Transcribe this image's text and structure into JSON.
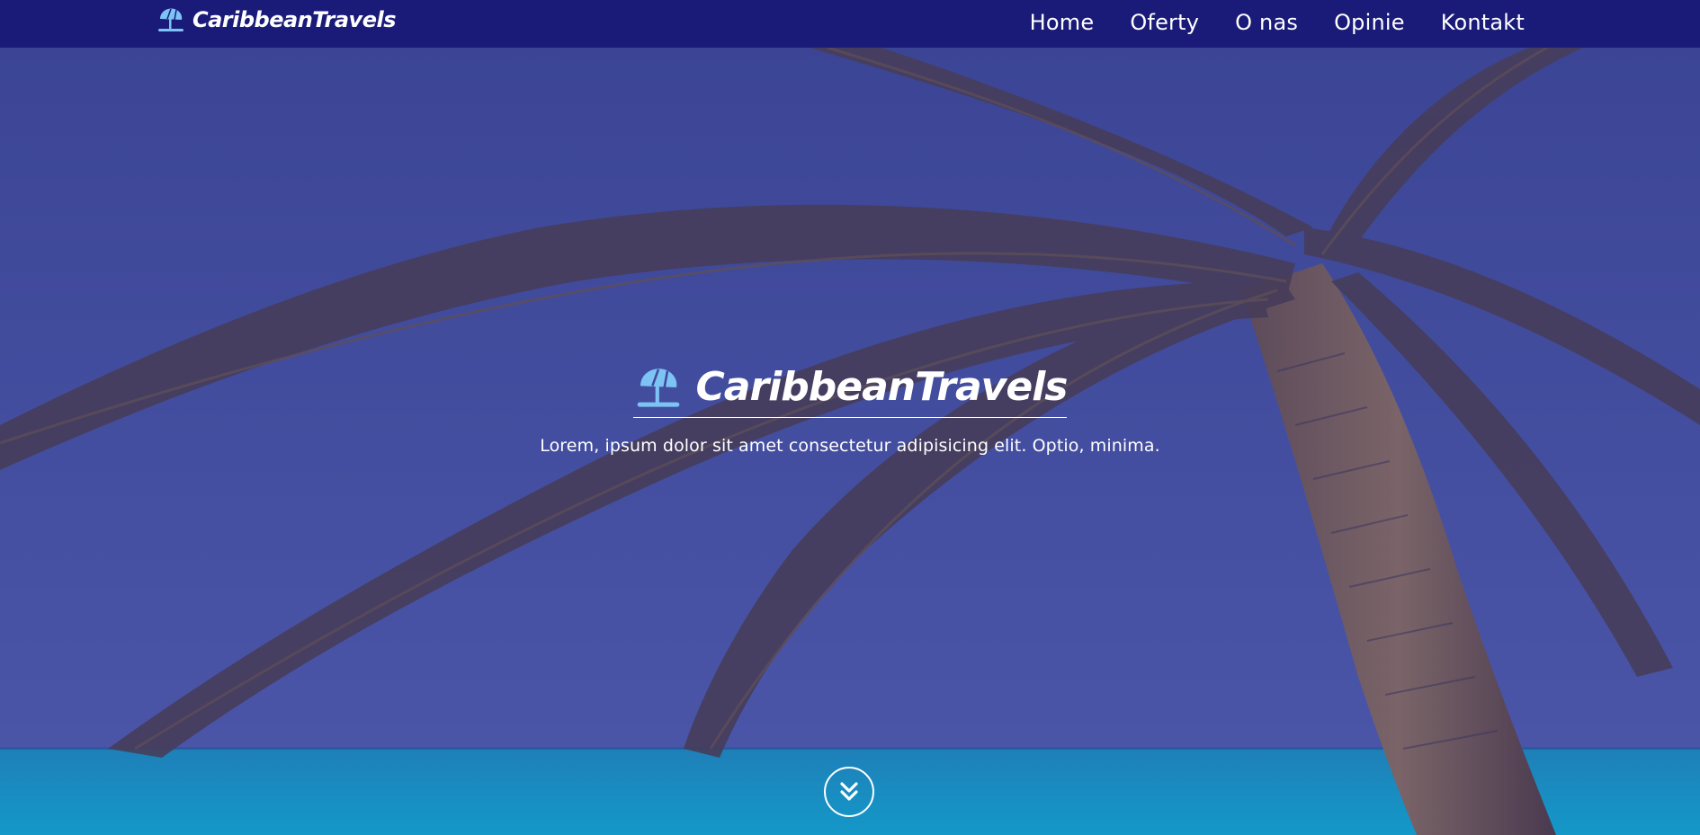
{
  "brand": {
    "name": "CaribbeanTravels",
    "icon": "umbrella-beach-icon"
  },
  "nav": {
    "items": [
      {
        "label": "Home"
      },
      {
        "label": "Oferty"
      },
      {
        "label": "O nas"
      },
      {
        "label": "Opinie"
      },
      {
        "label": "Kontakt"
      }
    ]
  },
  "hero": {
    "title": "CaribbeanTravels",
    "subtitle": "Lorem, ipsum dolor sit amet consectetur adipisicing elit. Optio, minima.",
    "scroll_icon": "double-chevron-down-icon",
    "background_image": "palm-tree-beach"
  },
  "colors": {
    "navbar": "#1a1a78",
    "overlay": "#3e4798",
    "accent": "#7dc3f4",
    "text": "#ffffff"
  }
}
